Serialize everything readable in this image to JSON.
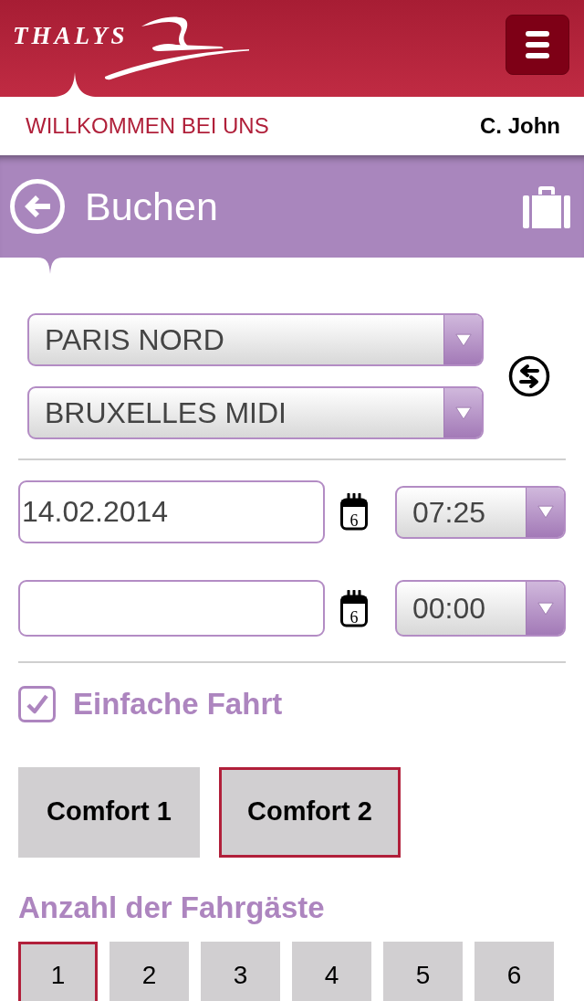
{
  "header": {
    "logo": "THALYS"
  },
  "welcome_bar": {
    "greeting": "WILLKOMMEN BEI UNS",
    "user": "C. John"
  },
  "title_bar": {
    "title": "Buchen"
  },
  "stations": [
    {
      "value": "PARIS NORD"
    },
    {
      "value": "BRUXELLES MIDI"
    }
  ],
  "schedule": [
    {
      "date": "14.02.2014",
      "calendar_day": "6",
      "time": "07:25"
    },
    {
      "calendar_day": "6",
      "time": "00:00"
    }
  ],
  "one_way": {
    "label": "Einfache Fahrt",
    "checked": true
  },
  "comfort_classes": [
    {
      "label": "Comfort 1",
      "selected": false
    },
    {
      "label": "Comfort 2",
      "selected": true
    }
  ],
  "passengers": {
    "title": "Anzahl der Fahrgäste",
    "options": [
      {
        "label": "1",
        "selected": true
      },
      {
        "label": "2",
        "selected": false
      },
      {
        "label": "3",
        "selected": false
      },
      {
        "label": "4",
        "selected": false
      },
      {
        "label": "5",
        "selected": false
      },
      {
        "label": "6",
        "selected": false
      }
    ]
  }
}
